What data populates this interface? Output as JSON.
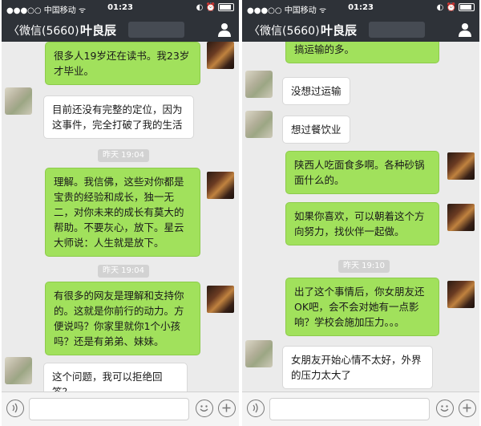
{
  "screens": [
    {
      "status": {
        "carrier": "●●●○○ 中国移动 ᯤ",
        "time": "01:23",
        "indicators": "◐ ⏰"
      },
      "nav": {
        "back_label": "微信(5660)",
        "title": "叶良辰"
      },
      "messages": [
        {
          "type": "out",
          "text": "很多人19岁还在读书。我23岁才毕业。"
        },
        {
          "type": "in",
          "text": "目前还没有完整的定位，因为这事件，完全打破了我的生活"
        },
        {
          "type": "time",
          "text": "昨天 19:04"
        },
        {
          "type": "out",
          "text": "理解。我信佛，这些对你都是宝贵的经验和成长，独一无二，对你未来的成长有莫大的帮助。不要灰心，放下。星云大师说：人生就是放下。"
        },
        {
          "type": "time",
          "text": "昨天 19:04"
        },
        {
          "type": "out",
          "text": "有很多的网友是理解和支持你的。这就是你前行的动力。方便说吗？你家里就你1个小孩吗？还是有弟弟、妹妹。"
        },
        {
          "type": "in",
          "text": "这个问题，我可以拒绝回答？"
        }
      ]
    },
    {
      "status": {
        "carrier": "●●●○○ 中国移动 ᯤ",
        "time": "01:23",
        "indicators": "◐ ⏰"
      },
      "nav": {
        "back_label": "微信(5660)",
        "title": "叶良辰"
      },
      "messages": [
        {
          "type": "out",
          "text": "搞运输的多。"
        },
        {
          "type": "in",
          "text": "没想过运输"
        },
        {
          "type": "in",
          "text": "想过餐饮业"
        },
        {
          "type": "out",
          "text": "陕西人吃面食多啊。各种砂锅面什么的。"
        },
        {
          "type": "out",
          "text": "如果你喜欢，可以朝着这个方向努力，找伙伴一起做。"
        },
        {
          "type": "time",
          "text": "昨天 19:10"
        },
        {
          "type": "out",
          "text": "出了这个事情后，你女朋友还OK吧，会不会对她有一点影响？学校会施加压力。。。"
        },
        {
          "type": "in",
          "text": "女朋友开始心情不太好，外界的压力太大了"
        }
      ]
    }
  ],
  "colors": {
    "header": "#2e3238",
    "chat_bg": "#ebebeb",
    "bubble_out": "#a1e15c",
    "bubble_in": "#ffffff",
    "timestamp_bg": "#d2d2d2"
  },
  "icons": [
    "chevron-left-icon",
    "user-icon",
    "voice-icon",
    "emoji-icon",
    "plus-icon",
    "wifi-icon",
    "battery-icon"
  ]
}
